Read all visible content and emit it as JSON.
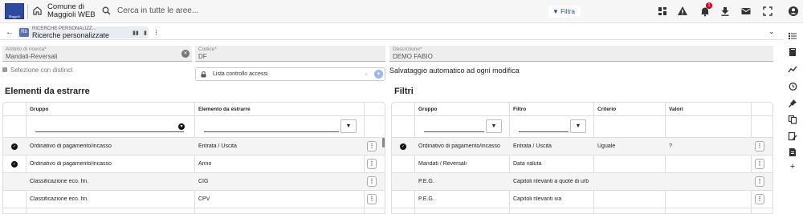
{
  "header": {
    "logo_text": "Maggioli",
    "app_name_line1": "Comune di",
    "app_name_line2": "Maggioli WEB",
    "search_placeholder": "Cerca in tutte le aree...",
    "filter_label": "Filtra",
    "notification_count": "1",
    "icons": [
      "dashboard-icon",
      "alert-icon",
      "bell-icon",
      "download-icon",
      "mail-icon",
      "fullscreen-icon",
      "account-icon"
    ]
  },
  "tabbar": {
    "tab_parent": "RICERCHE PERSONALIZZ...",
    "tab_title": "Ricerche personalizzate",
    "tab_icon": "Rb"
  },
  "form": {
    "ambito_label": "Ambito di ricerca",
    "ambito_value": "Mandati-Reversali",
    "codice_label": "Codice",
    "codice_value": "DF",
    "descrizione_label": "Descrizione",
    "descrizione_value": "DEMO FABIO",
    "distinct_label": "Selezione con distinct",
    "lista_label": "Lista controllo accessi",
    "autosave_text": "Salvataggio automatico ad ogni modifica",
    "required_mark": "*"
  },
  "elementi": {
    "title": "Elementi da estrarre",
    "columns": [
      "Gruppo",
      "Elemento da estrarre"
    ],
    "rows": [
      {
        "checked": true,
        "gruppo": "Ordinativo di pagamento/incasso",
        "elemento": "Entrata / Uscita"
      },
      {
        "checked": true,
        "gruppo": "Ordinativo di pagamento/incasso",
        "elemento": "Anno"
      },
      {
        "checked": false,
        "gruppo": "Classificazione eco. fin.",
        "elemento": "CIG"
      },
      {
        "checked": false,
        "gruppo": "Classificazione eco. fin.",
        "elemento": "CPV"
      }
    ]
  },
  "filtri": {
    "title": "Filtri",
    "columns": [
      "Gruppo",
      "Filtro",
      "Criterio",
      "Valori"
    ],
    "rows": [
      {
        "checked": true,
        "gruppo": "Ordinativo di pagamento/incasso",
        "filtro": "Entrata / Uscita",
        "criterio": "Uguale",
        "valori": "?"
      },
      {
        "checked": false,
        "gruppo": "Mandati / Reversali",
        "filtro": "Data valuta",
        "criterio": "",
        "valori": ""
      },
      {
        "checked": false,
        "gruppo": "P.E.G.",
        "filtro": "Capitoli rilevanti a quote di urb",
        "criterio": "",
        "valori": ""
      },
      {
        "checked": false,
        "gruppo": "P.E.G.",
        "filtro": "Capitoli rilevanti iva",
        "criterio": "",
        "valori": ""
      }
    ]
  },
  "rightbar": {
    "icons": [
      "list-icon",
      "book-icon",
      "trend-icon",
      "history-icon",
      "pin-icon",
      "copy-icon",
      "edit-doc-icon",
      "export-icon",
      "plus-icon"
    ],
    "plus_glyph": "+"
  },
  "colors": {
    "accent": "#1d4e9e",
    "badge": "#d0021b",
    "logo": "#2c4aa0"
  }
}
